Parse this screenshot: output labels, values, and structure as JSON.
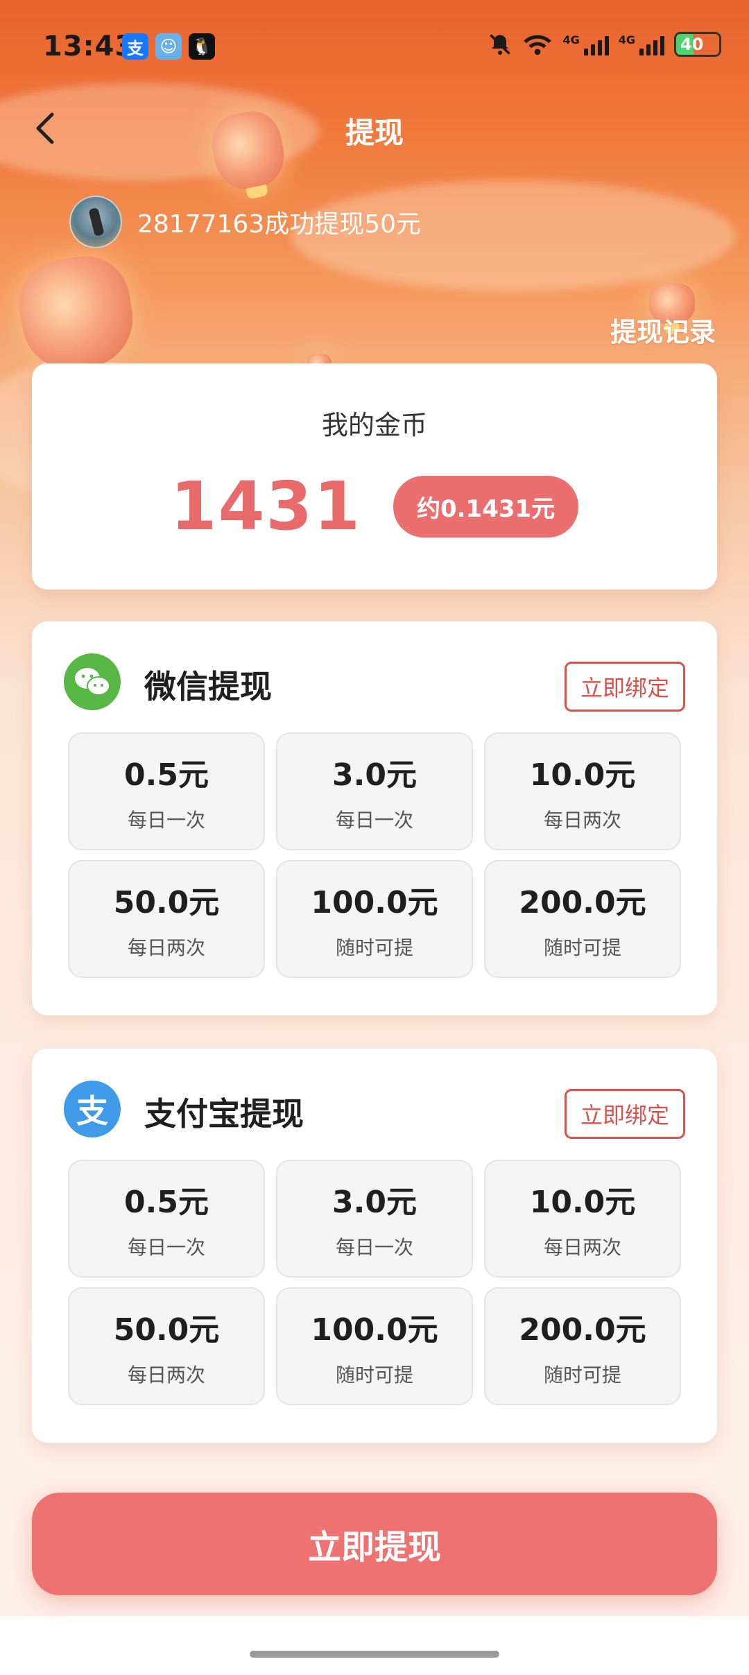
{
  "status_bar": {
    "time": "13:43",
    "app_icons": [
      {
        "name": "alipay-icon",
        "glyph": "支",
        "color": "#1677ff"
      },
      {
        "name": "app-avatar-icon",
        "glyph": "☺",
        "color": "#6ab0e8"
      },
      {
        "name": "qq-icon",
        "glyph": "🐧",
        "color": "#111111"
      }
    ],
    "network_labels": [
      "4G",
      "4G"
    ],
    "battery": {
      "text": "40",
      "level": 0.4
    }
  },
  "header": {
    "title": "提现"
  },
  "ticker": {
    "text": "28177163成功提现50元"
  },
  "record_link": "提现记录",
  "coins": {
    "label": "我的金币",
    "value": "1431",
    "approx": "约0.1431元"
  },
  "wechat": {
    "title": "微信提现",
    "bind_label": "立即绑定",
    "brand_color": "#57b846",
    "options": [
      {
        "amount": "0.5元",
        "freq": "每日一次"
      },
      {
        "amount": "3.0元",
        "freq": "每日一次"
      },
      {
        "amount": "10.0元",
        "freq": "每日两次"
      },
      {
        "amount": "50.0元",
        "freq": "每日两次"
      },
      {
        "amount": "100.0元",
        "freq": "随时可提"
      },
      {
        "amount": "200.0元",
        "freq": "随时可提"
      }
    ]
  },
  "alipay": {
    "title": "支付宝提现",
    "bind_label": "立即绑定",
    "brand_color": "#3f9be8",
    "logo_glyph": "支",
    "options": [
      {
        "amount": "0.5元",
        "freq": "每日一次"
      },
      {
        "amount": "3.0元",
        "freq": "每日一次"
      },
      {
        "amount": "10.0元",
        "freq": "每日两次"
      },
      {
        "amount": "50.0元",
        "freq": "每日两次"
      },
      {
        "amount": "100.0元",
        "freq": "随时可提"
      },
      {
        "amount": "200.0元",
        "freq": "随时可提"
      }
    ]
  },
  "submit_label": "立即提现",
  "colors": {
    "accent": "#ee7271",
    "bind_border": "#d9534a",
    "coin_value": "#e96a6a"
  }
}
